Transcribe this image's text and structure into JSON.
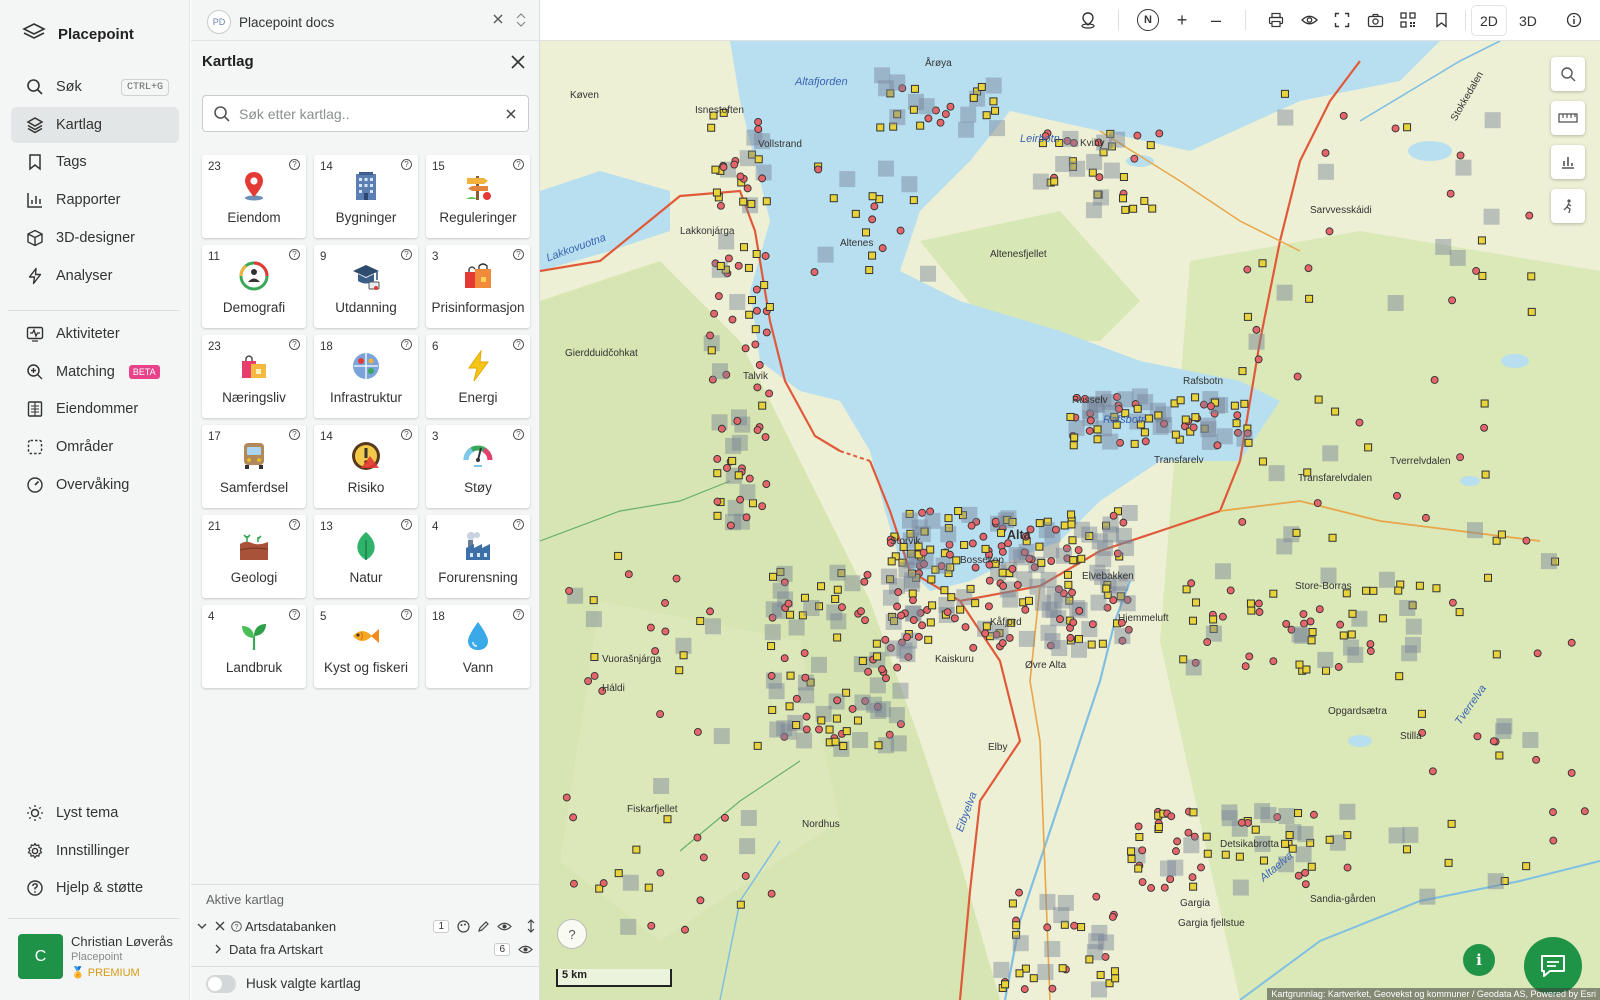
{
  "nav": {
    "brand": "Placepoint",
    "items": [
      {
        "label": "Søk",
        "icon": "search-icon",
        "shortcut": "CTRL+G"
      },
      {
        "label": "Kartlag",
        "icon": "layers-icon",
        "active": true
      },
      {
        "label": "Tags",
        "icon": "bookmark-icon"
      },
      {
        "label": "Rapporter",
        "icon": "bar-chart-icon"
      },
      {
        "label": "3D-designer",
        "icon": "cube-icon"
      },
      {
        "label": "Analyser",
        "icon": "bolt-icon"
      }
    ],
    "items2": [
      {
        "label": "Aktiviteter",
        "icon": "activity-icon"
      },
      {
        "label": "Matching",
        "icon": "match-icon",
        "badge": "BETA"
      },
      {
        "label": "Eiendommer",
        "icon": "building-list-icon"
      },
      {
        "label": "Områder",
        "icon": "area-icon"
      },
      {
        "label": "Overvåking",
        "icon": "gauge-icon"
      }
    ],
    "bottom": [
      {
        "label": "Lyst tema",
        "icon": "sun-icon"
      },
      {
        "label": "Innstillinger",
        "icon": "gear-icon"
      },
      {
        "label": "Hjelp & støtte",
        "icon": "help-icon"
      }
    ],
    "user": {
      "initial": "C",
      "name": "Christian Løverås",
      "org": "Placepoint",
      "plan": "PREMIUM"
    }
  },
  "panel": {
    "doc_badge": "PD",
    "doc_title": "Placepoint docs",
    "title": "Kartlag",
    "search_placeholder": "Søk etter kartlag..",
    "help_glyph": "?",
    "categories": [
      {
        "count": "23",
        "label": "Eiendom",
        "icon": "location-pin-icon",
        "selected": true
      },
      {
        "count": "14",
        "label": "Bygninger",
        "icon": "office-building-icon"
      },
      {
        "count": "15",
        "label": "Reguleringer",
        "icon": "signpost-icon"
      },
      {
        "count": "11",
        "label": "Demografi",
        "icon": "demography-icon"
      },
      {
        "count": "9",
        "label": "Utdanning",
        "icon": "graduation-cap-icon"
      },
      {
        "count": "3",
        "label": "Prisinformasjon",
        "icon": "shopping-bags-icon"
      },
      {
        "count": "23",
        "label": "Næringsliv",
        "icon": "shopping-bag-icon"
      },
      {
        "count": "18",
        "label": "Infrastruktur",
        "icon": "infrastructure-icon"
      },
      {
        "count": "6",
        "label": "Energi",
        "icon": "lightning-icon"
      },
      {
        "count": "17",
        "label": "Samferdsel",
        "icon": "bus-icon"
      },
      {
        "count": "14",
        "label": "Risiko",
        "icon": "warning-icon"
      },
      {
        "count": "3",
        "label": "Støy",
        "icon": "noise-gauge-icon"
      },
      {
        "count": "21",
        "label": "Geologi",
        "icon": "soil-icon"
      },
      {
        "count": "13",
        "label": "Natur",
        "icon": "leaf-icon"
      },
      {
        "count": "4",
        "label": "Forurensning",
        "icon": "factory-icon"
      },
      {
        "count": "4",
        "label": "Landbruk",
        "icon": "sprout-icon"
      },
      {
        "count": "5",
        "label": "Kyst og fiskeri",
        "icon": "fish-icon"
      },
      {
        "count": "18",
        "label": "Vann",
        "icon": "water-drop-icon"
      }
    ],
    "active_title": "Aktive kartlag",
    "active_layer": {
      "name": "Artsdatabanken",
      "count": "1"
    },
    "sub_layer": {
      "name": "Data fra Artskart",
      "count": "6"
    },
    "remember_label": "Husk valgte kartlag"
  },
  "topbar": {
    "compass": "N",
    "zoom_in": "+",
    "zoom_out": "–",
    "mode_2d": "2D",
    "mode_3d": "3D"
  },
  "map": {
    "scale": "5 km",
    "attribution": "Kartgrunnlag: Kartverket, Geovekst og kommuner / Geodata AS, Powered by Esri",
    "help": "?",
    "labels": [
      {
        "text": "Alta",
        "cls": "big"
      },
      {
        "text": "Altafjorden",
        "cls": "water"
      },
      {
        "text": "Rafsbotn",
        "cls": "water"
      },
      {
        "text": "Leirbotn",
        "cls": "water"
      },
      {
        "text": "Isnestoften",
        "cls": ""
      },
      {
        "text": "Vollstrand",
        "cls": ""
      },
      {
        "text": "Altenes",
        "cls": ""
      },
      {
        "text": "Talvik",
        "cls": ""
      },
      {
        "text": "Storvik",
        "cls": ""
      },
      {
        "text": "Bossekop",
        "cls": ""
      },
      {
        "text": "Elvebakken",
        "cls": ""
      },
      {
        "text": "Store-Borras",
        "cls": ""
      },
      {
        "text": "Transfarelvdalen",
        "cls": ""
      },
      {
        "text": "Kviby",
        "cls": ""
      },
      {
        "text": "Russelv",
        "cls": ""
      },
      {
        "text": "Elby",
        "cls": ""
      },
      {
        "text": "Nordhus",
        "cls": ""
      },
      {
        "text": "Fiskarfjellet",
        "cls": ""
      },
      {
        "text": "Detsikabrotta",
        "cls": ""
      },
      {
        "text": "Gargia",
        "cls": ""
      },
      {
        "text": "Stilla",
        "cls": ""
      },
      {
        "text": "Sarvvesskáidi",
        "cls": ""
      },
      {
        "text": "Køven",
        "cls": ""
      },
      {
        "text": "Årøya",
        "cls": ""
      },
      {
        "text": "Vuorašnjárga",
        "cls": ""
      },
      {
        "text": "Gierdduidčohkat",
        "cls": ""
      },
      {
        "text": "Opgardsætra",
        "cls": ""
      },
      {
        "text": "Sandia-gården",
        "cls": ""
      },
      {
        "text": "Gargia fjellstue",
        "cls": ""
      },
      {
        "text": "Altaelva",
        "cls": "water"
      },
      {
        "text": "Eibyelva",
        "cls": "water"
      },
      {
        "text": "Tverrelva",
        "cls": "water"
      },
      {
        "text": "Lakkovuotna",
        "cls": "water"
      },
      {
        "text": "Lakkonjárga",
        "cls": ""
      },
      {
        "text": "Transfarelv",
        "cls": ""
      },
      {
        "text": "Øvre Alta",
        "cls": ""
      },
      {
        "text": "Kaiskuru",
        "cls": ""
      },
      {
        "text": "Kåfjord",
        "cls": ""
      },
      {
        "text": "Altenesfjellet",
        "cls": ""
      },
      {
        "text": "Rafsbotn",
        "cls": ""
      },
      {
        "text": "Tverrelvdalen",
        "cls": ""
      },
      {
        "text": "Stokkedalen",
        "cls": ""
      },
      {
        "text": "Háldi",
        "cls": ""
      },
      {
        "text": "Hjemmeluft",
        "cls": ""
      }
    ]
  }
}
